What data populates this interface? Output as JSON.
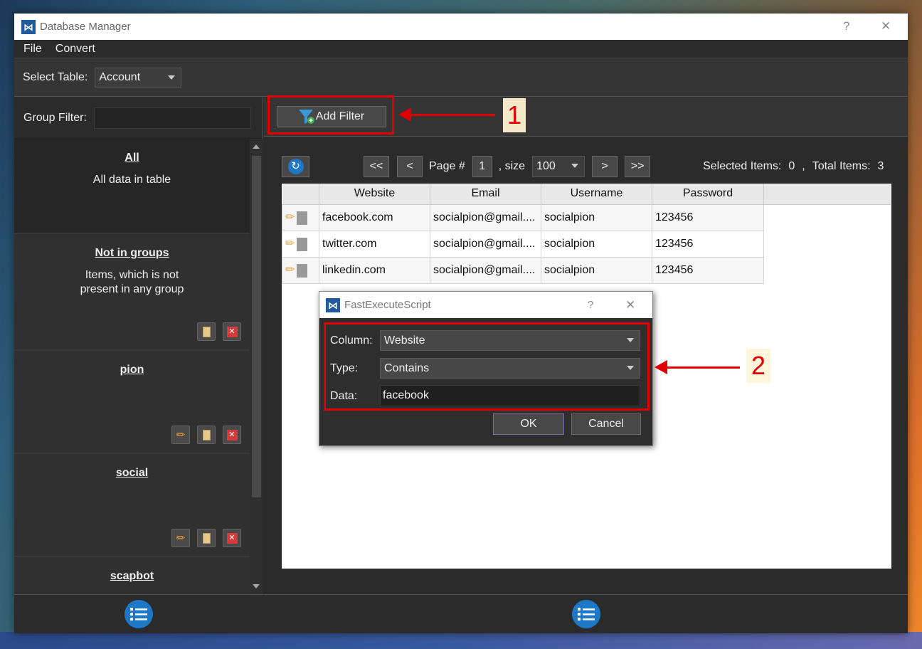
{
  "window": {
    "title": "Database Manager",
    "help": "?",
    "close": "✕"
  },
  "menu": {
    "file": "File",
    "convert": "Convert"
  },
  "toolbar": {
    "select_table_label": "Select Table:",
    "table_value": "Account"
  },
  "left": {
    "group_filter_label": "Group Filter:",
    "groups": [
      {
        "name": "All",
        "desc": "All data in table"
      },
      {
        "name": "Not in groups",
        "desc": "Items, which is not\npresent in any group"
      },
      {
        "name": "pion",
        "desc": ""
      },
      {
        "name": "social",
        "desc": ""
      },
      {
        "name": "scapbot",
        "desc": ""
      }
    ]
  },
  "filter_bar": {
    "add_filter_label": "Add Filter"
  },
  "annotations": {
    "one": "1",
    "two": "2"
  },
  "pager": {
    "first": "<<",
    "prev": "<",
    "page_label": "Page #",
    "page_value": "1",
    "size_label": ", size",
    "size_value": "100",
    "next": ">",
    "last": ">>",
    "selected_label": "Selected Items:",
    "selected_value": "0",
    "sep": ",",
    "total_label": "Total Items:",
    "total_value": "3"
  },
  "table": {
    "headers": [
      "Website",
      "Email",
      "Username",
      "Password"
    ],
    "rows": [
      [
        "facebook.com",
        "socialpion@gmail....",
        "socialpion",
        "123456"
      ],
      [
        "twitter.com",
        "socialpion@gmail....",
        "socialpion",
        "123456"
      ],
      [
        "linkedin.com",
        "socialpion@gmail....",
        "socialpion",
        "123456"
      ]
    ]
  },
  "dialog": {
    "title": "FastExecuteScript",
    "help": "?",
    "close": "✕",
    "column_label": "Column:",
    "column_value": "Website",
    "type_label": "Type:",
    "type_value": "Contains",
    "data_label": "Data:",
    "data_value": "facebook",
    "ok": "OK",
    "cancel": "Cancel"
  },
  "colors": {
    "accent": "#1e78c8",
    "annotation": "#e00000"
  }
}
